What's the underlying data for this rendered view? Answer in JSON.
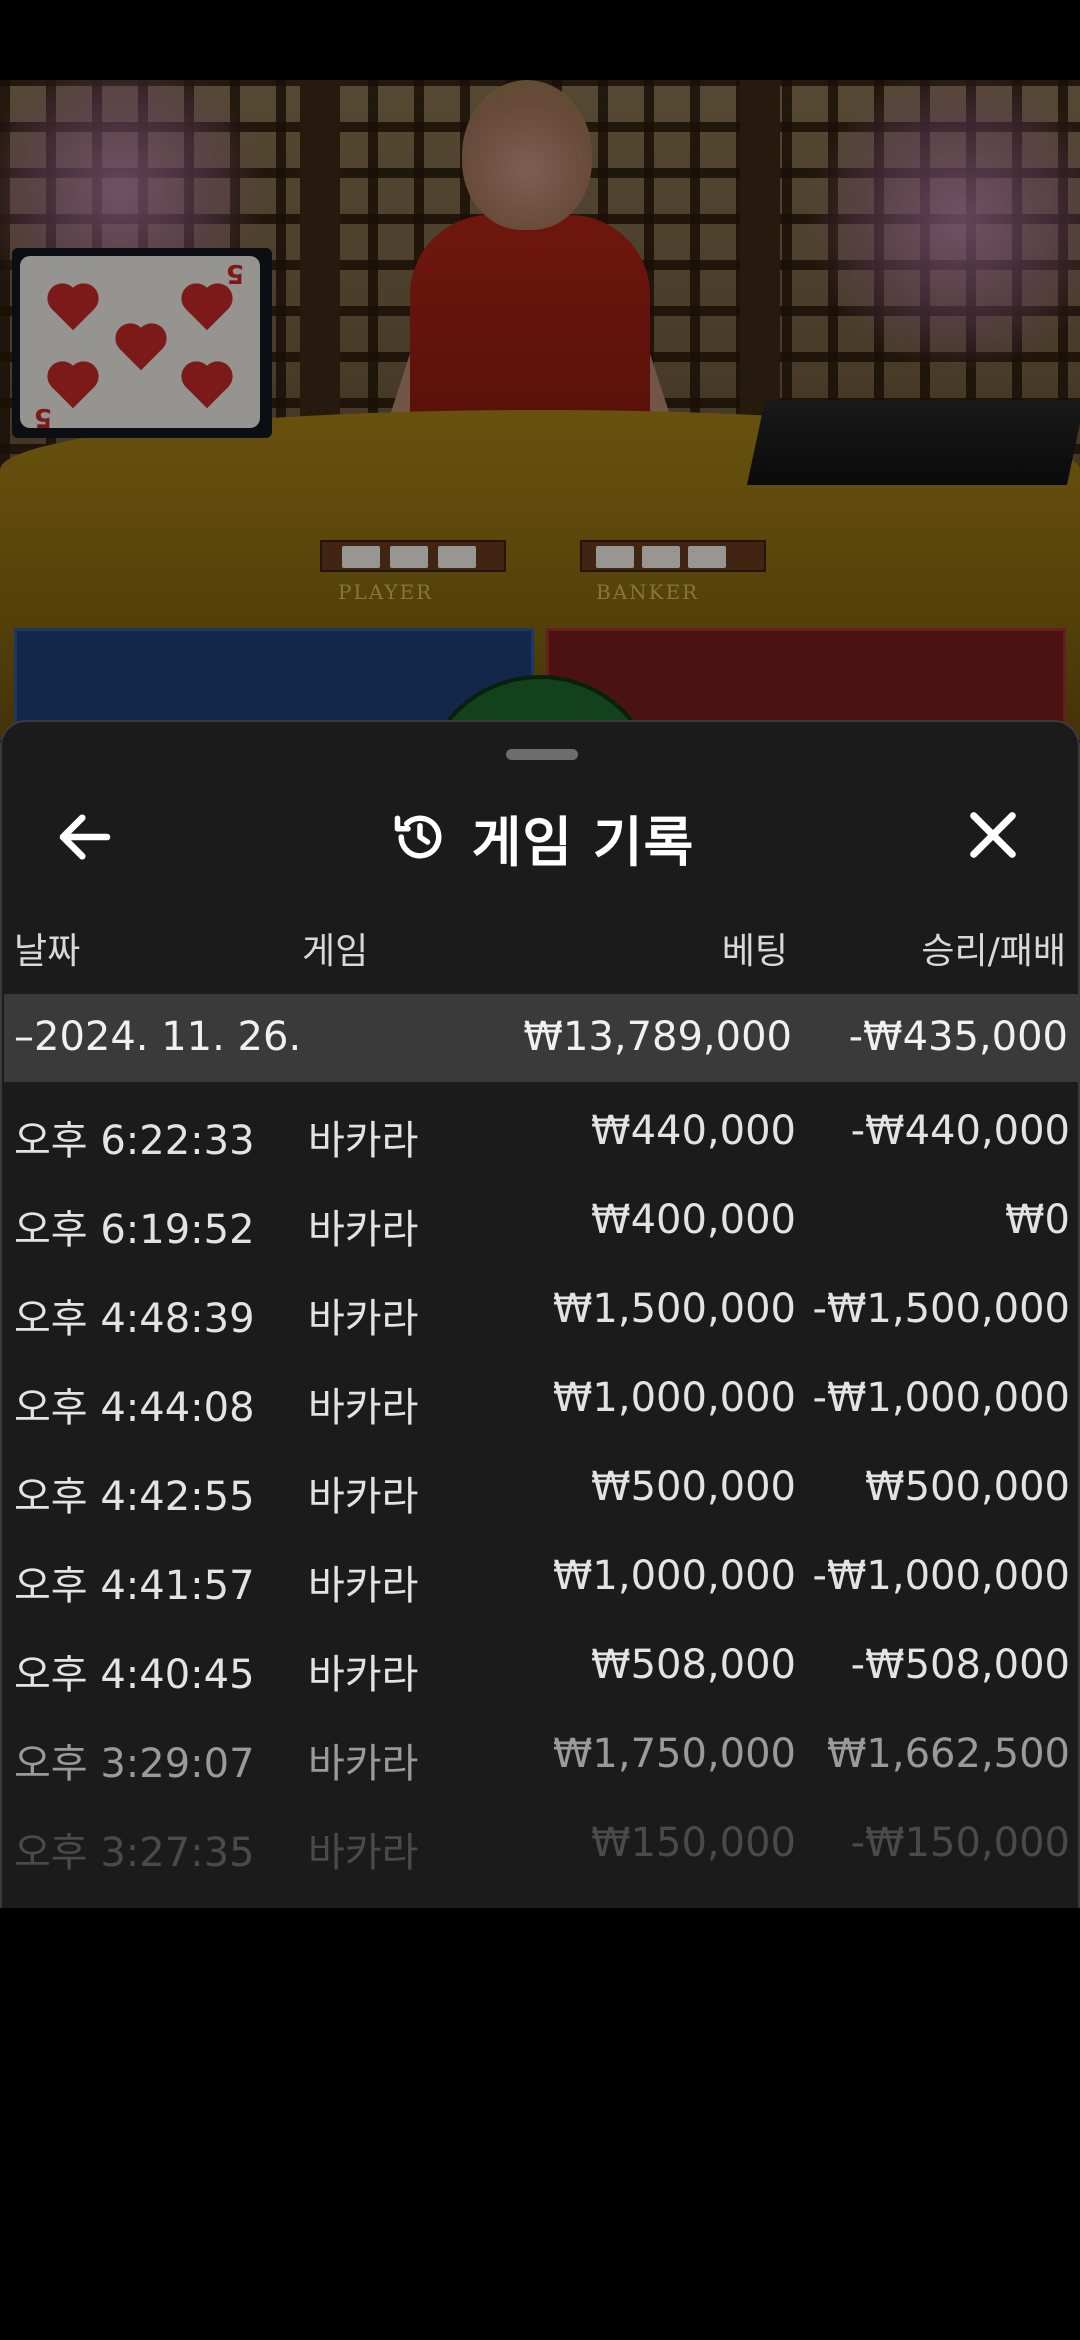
{
  "sheet": {
    "title": "게임 기록",
    "icons": {
      "back": "arrow-left-icon",
      "history": "history-icon",
      "close": "close-icon"
    }
  },
  "video": {
    "table_labels": {
      "player": "PLAYER",
      "banker": "BANKER"
    },
    "card_rank": "5"
  },
  "columns": {
    "date": "날짜",
    "game": "게임",
    "bet": "베팅",
    "result": "승리/패배"
  },
  "summary": {
    "date": "–2024. 11. 26.",
    "bet": "₩13,789,000",
    "result": "-₩435,000"
  },
  "rows": [
    {
      "time": "오후 6:22:33",
      "game": "바카라",
      "bet": "₩440,000",
      "result": "-₩440,000"
    },
    {
      "time": "오후 6:19:52",
      "game": "바카라",
      "bet": "₩400,000",
      "result": "₩0"
    },
    {
      "time": "오후 4:48:39",
      "game": "바카라",
      "bet": "₩1,500,000",
      "result": "-₩1,500,000"
    },
    {
      "time": "오후 4:44:08",
      "game": "바카라",
      "bet": "₩1,000,000",
      "result": "-₩1,000,000"
    },
    {
      "time": "오후 4:42:55",
      "game": "바카라",
      "bet": "₩500,000",
      "result": "₩500,000"
    },
    {
      "time": "오후 4:41:57",
      "game": "바카라",
      "bet": "₩1,000,000",
      "result": "-₩1,000,000"
    },
    {
      "time": "오후 4:40:45",
      "game": "바카라",
      "bet": "₩508,000",
      "result": "-₩508,000"
    },
    {
      "time": "오후 3:29:07",
      "game": "바카라",
      "bet": "₩1,750,000",
      "result": "₩1,662,500"
    },
    {
      "time": "오후 3:27:35",
      "game": "바카라",
      "bet": "₩150,000",
      "result": "-₩150,000"
    }
  ]
}
